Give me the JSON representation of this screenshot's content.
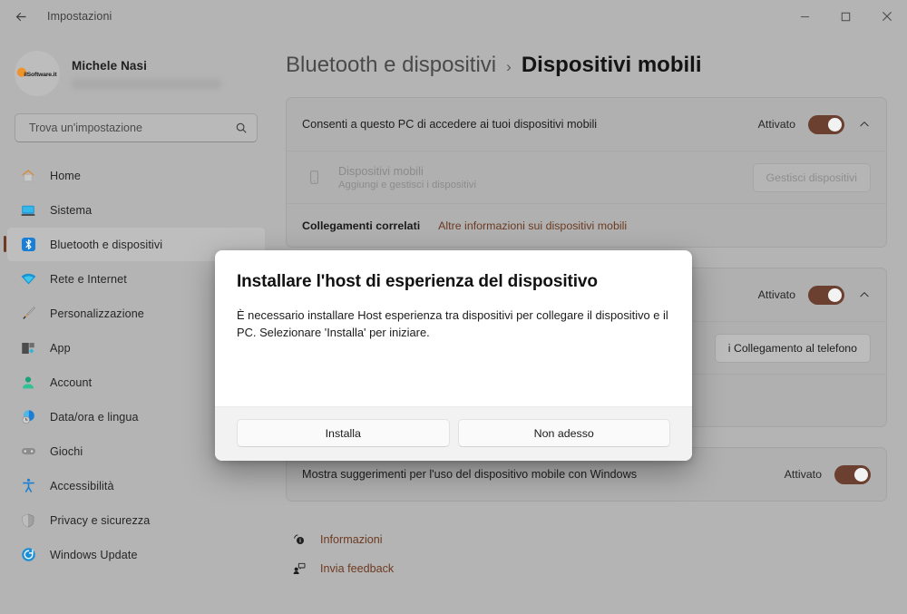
{
  "titlebar": {
    "back_icon": "arrow-left-icon",
    "title": "Impostazioni",
    "minimize_label": "─",
    "maximize_label": "□",
    "close_label": "✕"
  },
  "sidebar": {
    "account": {
      "avatar_icon": "user-avatar-ilsoftware-logo",
      "avatar_brand": "ilSoftware.it",
      "name": "Michele Nasi",
      "email_masked": ""
    },
    "search": {
      "placeholder": "Trova un'impostazione",
      "value": "",
      "icon": "search-icon"
    },
    "items": [
      {
        "label": "Home",
        "icon": "home-icon",
        "selected": false
      },
      {
        "label": "Sistema",
        "icon": "system-monitor-icon",
        "selected": false
      },
      {
        "label": "Bluetooth e dispositivi",
        "icon": "bluetooth-icon",
        "selected": true
      },
      {
        "label": "Rete e Internet",
        "icon": "wifi-icon",
        "selected": false
      },
      {
        "label": "Personalizzazione",
        "icon": "paintbrush-icon",
        "selected": false
      },
      {
        "label": "App",
        "icon": "apps-icon",
        "selected": false
      },
      {
        "label": "Account",
        "icon": "person-icon",
        "selected": false
      },
      {
        "label": "Data/ora e lingua",
        "icon": "clock-globe-icon",
        "selected": false
      },
      {
        "label": "Giochi",
        "icon": "gamepad-icon",
        "selected": false
      },
      {
        "label": "Accessibilità",
        "icon": "accessibility-icon",
        "selected": false
      },
      {
        "label": "Privacy e sicurezza",
        "icon": "shield-icon",
        "selected": false
      },
      {
        "label": "Windows Update",
        "icon": "update-refresh-icon",
        "selected": false
      }
    ]
  },
  "main": {
    "breadcrumb": {
      "parent": "Bluetooth e dispositivi",
      "separator": "›",
      "current": "Dispositivi mobili"
    },
    "card_mobile_devices": {
      "main_row": {
        "label": "Consenti a questo PC di accedere ai tuoi dispositivi mobili",
        "state": "Attivato",
        "toggle_on": true,
        "chevron": "chevron-up-icon"
      },
      "device_row": {
        "icon": "phone-icon",
        "title": "Dispositivi mobili",
        "subtitle": "Aggiungi e gestisci i dispositivi",
        "button": "Gestisci dispositivi",
        "button_disabled": true
      },
      "related": {
        "title": "Collegamenti correlati",
        "link": "Altre informazioni sui dispositivi mobili"
      }
    },
    "card_phone_link": {
      "main_row": {
        "state": "Attivato",
        "toggle_on": true,
        "chevron": "chevron-up-icon"
      },
      "action_button": "i Collegamento al telefono"
    },
    "card_suggestions": {
      "label": "Mostra suggerimenti per l'uso del dispositivo mobile con Windows",
      "state": "Attivato",
      "toggle_on": true
    },
    "footer_links": [
      {
        "label": "Informazioni",
        "icon": "help-info-icon"
      },
      {
        "label": "Invia feedback",
        "icon": "feedback-icon"
      }
    ]
  },
  "dialog": {
    "title": "Installare l'host di esperienza del dispositivo",
    "message": "È necessario installare Host esperienza tra dispositivi per collegare il dispositivo e il PC. Selezionare 'Installa' per iniziare.",
    "primary_button": "Installa",
    "secondary_button": "Non adesso"
  },
  "colors": {
    "accent_brown": "#6b4030",
    "link_brown": "#6d3a21",
    "window_bg": "#b4b4b4",
    "card_bg": "#b0b0b0",
    "dialog_bg": "#ffffff"
  }
}
